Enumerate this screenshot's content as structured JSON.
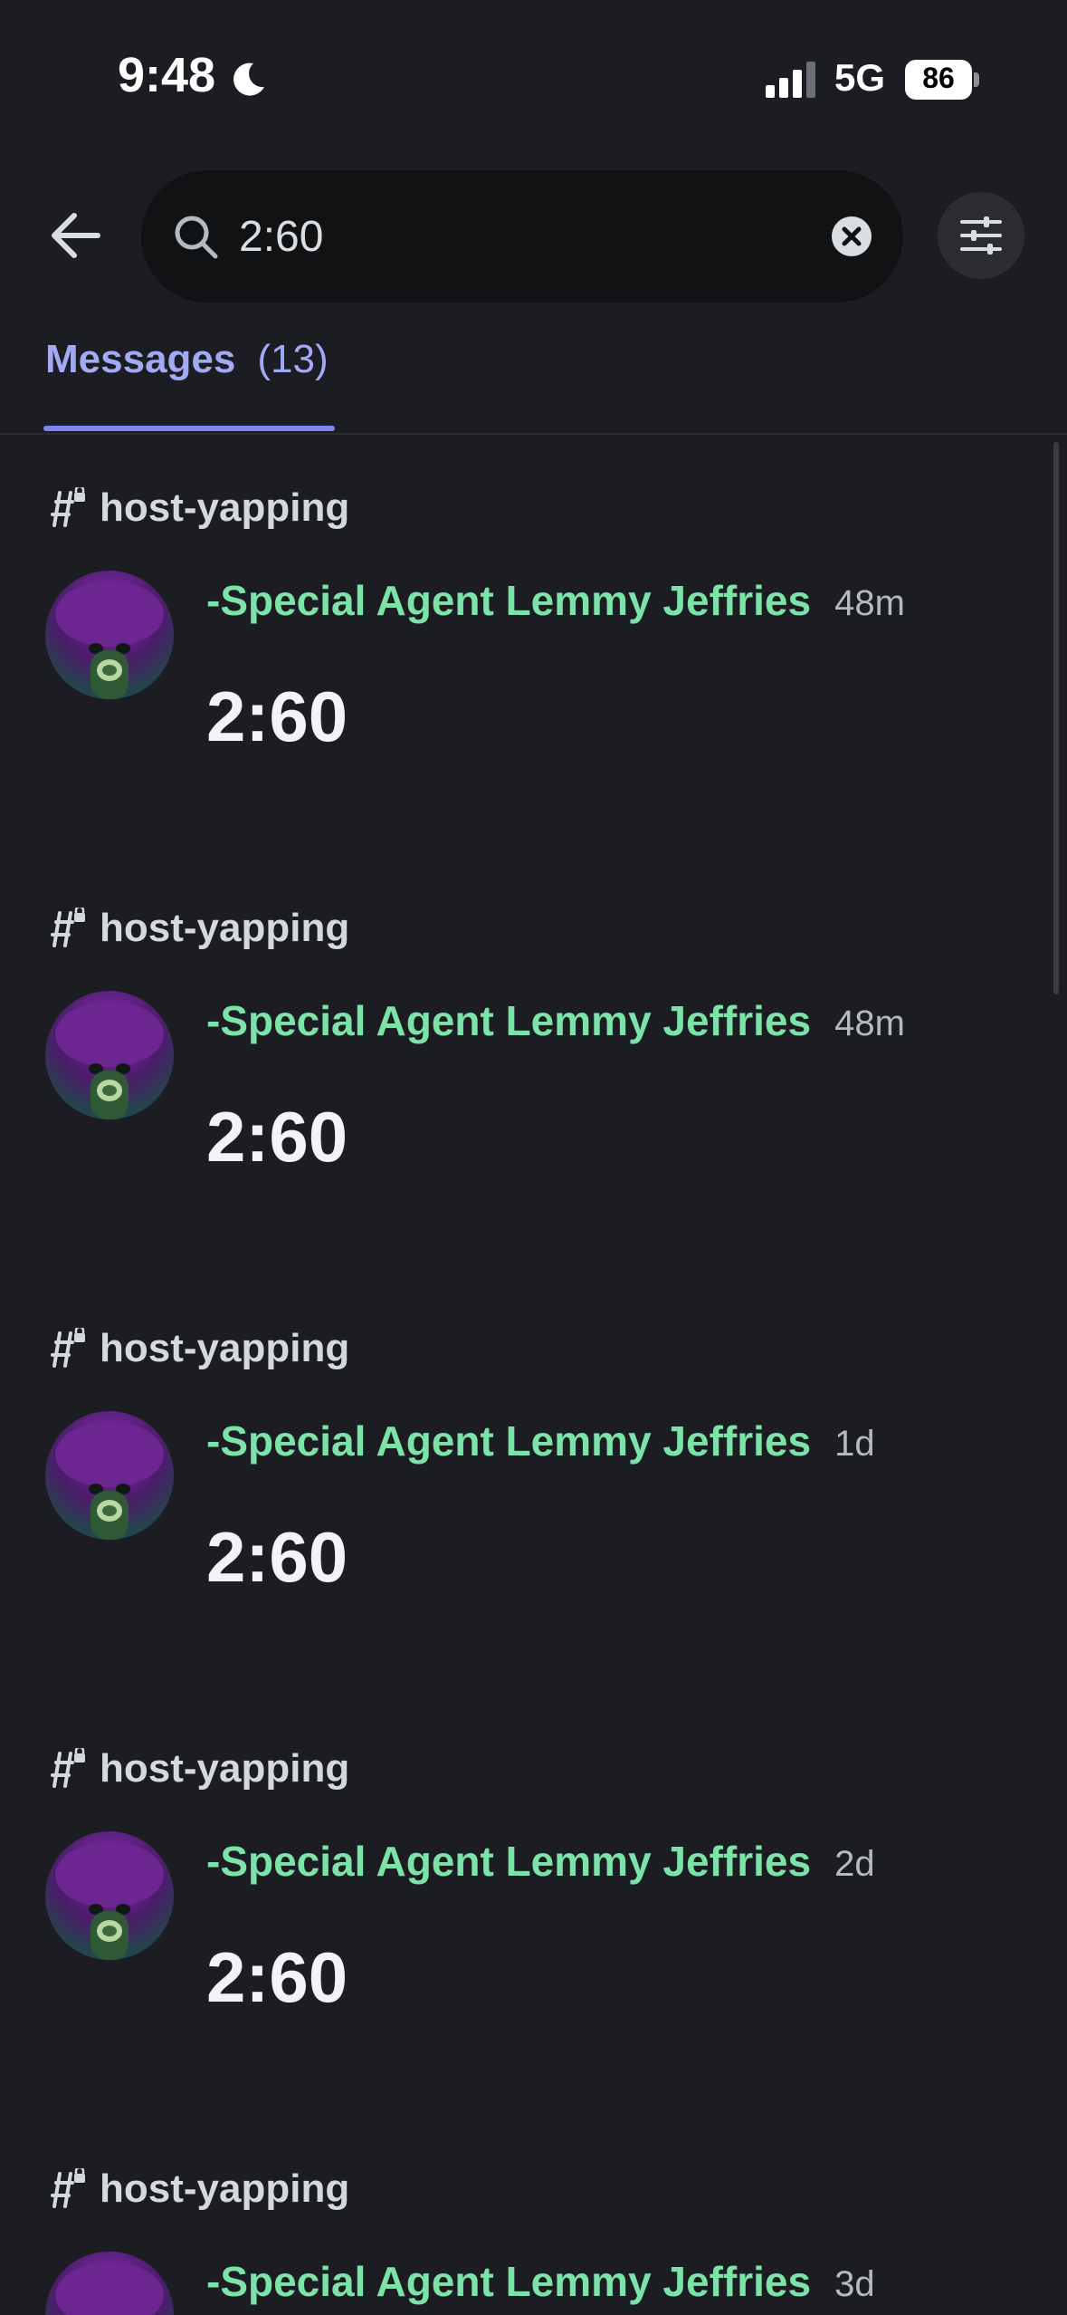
{
  "status_bar": {
    "time": "9:48",
    "network": "5G",
    "battery": "86"
  },
  "search": {
    "query": "2:60",
    "placeholder": "Search"
  },
  "tabs": [
    {
      "label": "Messages",
      "count": "(13)",
      "active": true
    }
  ],
  "results": [
    {
      "channel": "host-yapping",
      "author": "-Special Agent Lemmy Jeffries",
      "timestamp": "48m",
      "content": "2:60"
    },
    {
      "channel": "host-yapping",
      "author": "-Special Agent Lemmy Jeffries",
      "timestamp": "48m",
      "content": "2:60"
    },
    {
      "channel": "host-yapping",
      "author": "-Special Agent Lemmy Jeffries",
      "timestamp": "1d",
      "content": "2:60"
    },
    {
      "channel": "host-yapping",
      "author": "-Special Agent Lemmy Jeffries",
      "timestamp": "2d",
      "content": "2:60"
    },
    {
      "channel": "host-yapping",
      "author": "-Special Agent Lemmy Jeffries",
      "timestamp": "3d",
      "content": ""
    }
  ],
  "colors": {
    "background": "#1c1d22",
    "accent": "#a3aaf5",
    "author": "#7be3a7"
  },
  "icons": {
    "back": "arrow-left-icon",
    "search": "search-icon",
    "clear": "clear-circle-icon",
    "filter": "sliders-icon",
    "channel": "locked-channel-icon",
    "moon": "moon-icon",
    "signal": "cellular-signal-icon"
  }
}
